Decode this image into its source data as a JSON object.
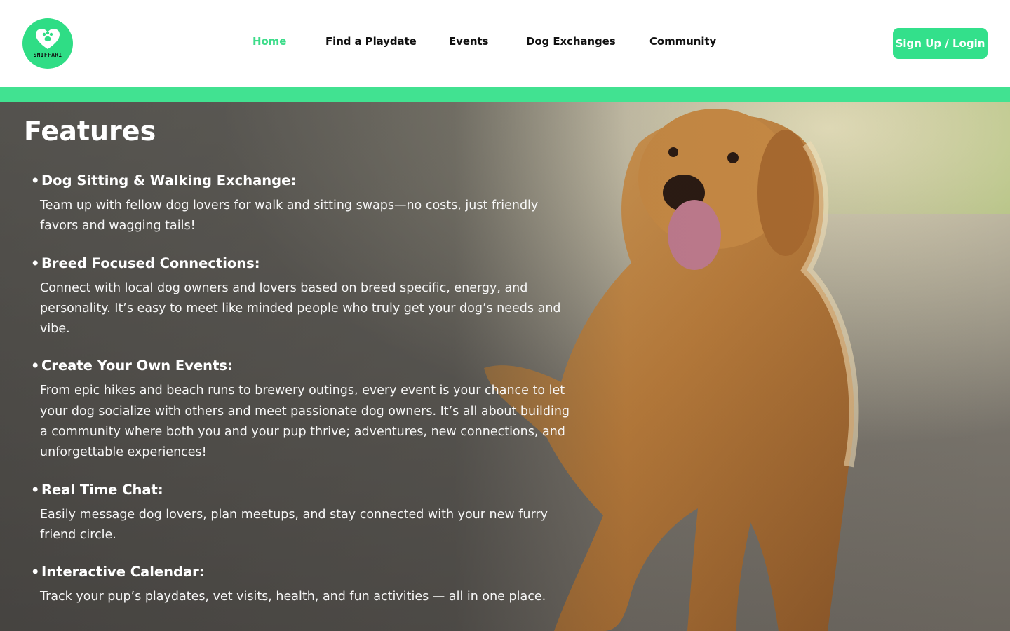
{
  "header": {
    "logo_text": "SNIFFARI",
    "nav": [
      {
        "label": "Home",
        "active": true
      },
      {
        "label": "Find a Playdate",
        "active": false
      },
      {
        "label": "Events",
        "active": false
      },
      {
        "label": "Dog Exchanges",
        "active": false
      },
      {
        "label": "Community",
        "active": false
      }
    ],
    "cta_label": "Sign Up / Login"
  },
  "colors": {
    "brand_green": "#33e08b",
    "active_nav": "#3ddc8a",
    "accent_bar": "#41e291"
  },
  "hero": {
    "image_subject": "golden retriever on gravel road",
    "title": "Features",
    "bullet": "•",
    "features": [
      {
        "heading": "Dog Sitting & Walking Exchange:",
        "body": "Team up with fellow dog lovers for walk and sitting swaps—no costs, just friendly favors and wagging tails!"
      },
      {
        "heading": "Breed Focused Connections:",
        "body": "Connect with local dog owners and lovers based on breed specific, energy, and personality. It’s easy to meet like minded people who truly get your dog’s needs and vibe."
      },
      {
        "heading": "Create Your Own Events:",
        "body": "From epic hikes and beach runs to brewery outings, every event is your chance to let your dog socialize with others and meet passionate dog owners. It’s all about building a community where both you and your pup thrive; adventures, new connections, and unforgettable experiences!"
      },
      {
        "heading": "Real Time Chat:",
        "body": "Easily message dog lovers, plan meetups, and stay connected with your new furry friend circle."
      },
      {
        "heading": "Interactive Calendar:",
        "body": "Track your pup’s playdates, vet visits, health, and fun activities — all in one place."
      }
    ]
  }
}
